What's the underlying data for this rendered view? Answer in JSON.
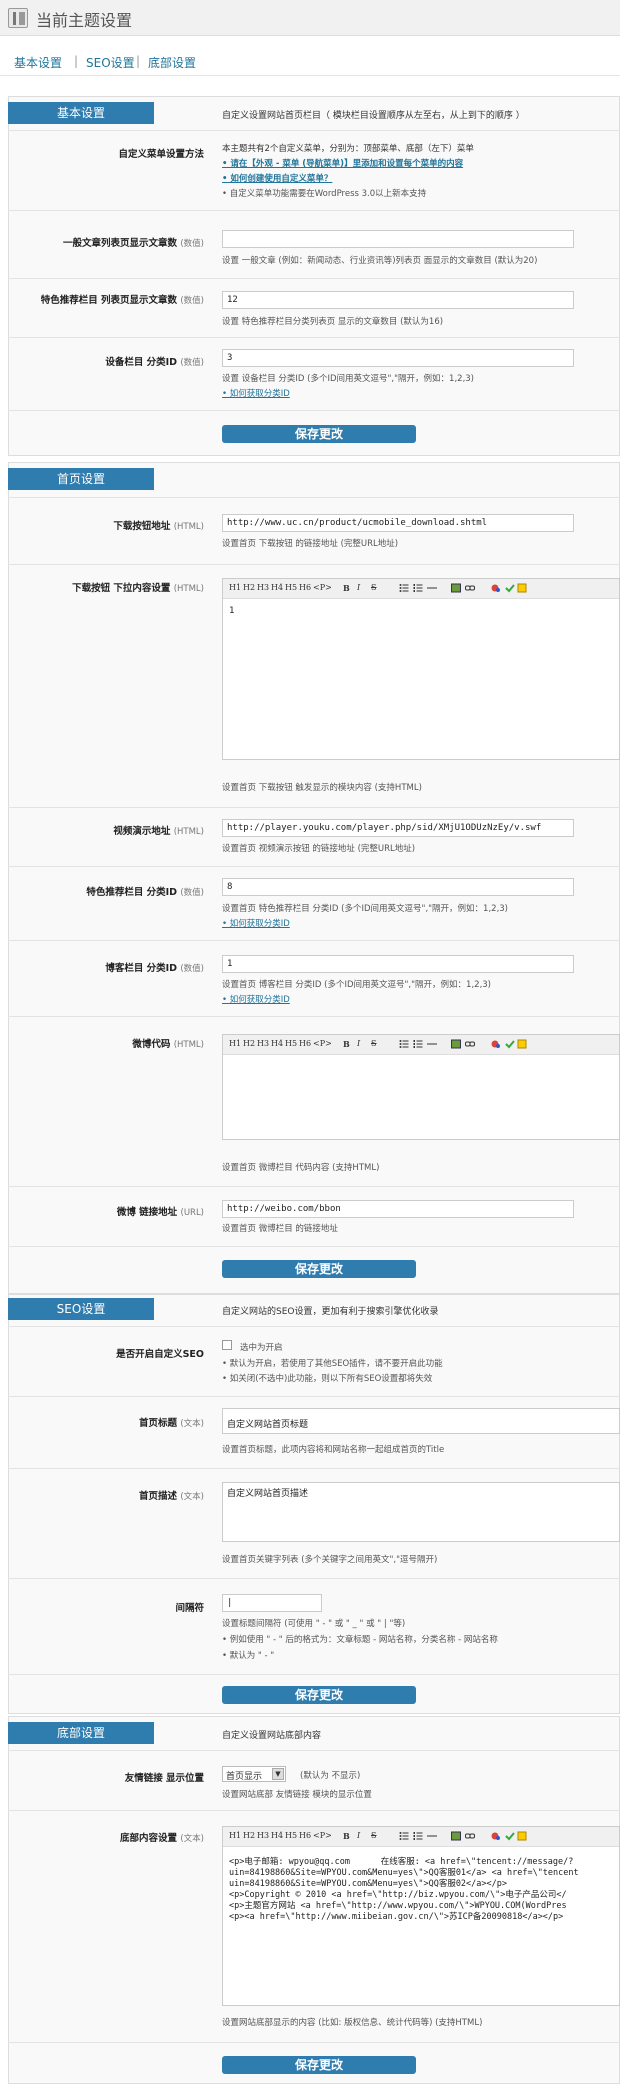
{
  "page": {
    "title": "当前主题设置"
  },
  "nav": {
    "items": [
      "基本设置",
      "SEO设置",
      "底部设置"
    ],
    "separator": "|"
  },
  "save_label": "保存更改",
  "basic": {
    "title": "基本设置",
    "desc": "自定义设置网站首页栏目（ 模块栏目设置顺序从左至右，从上到下的顺序 ）",
    "menu": {
      "label": "自定义菜单设置方法",
      "line1": "本主题共有2个自定义菜单，分别为：顶部菜单、底部（左下）菜单",
      "line2": "• 请在【外观 - 菜单 (导航菜单)】里添加和设置每个菜单的内容",
      "line3": "• 如何创建使用自定义菜单？",
      "line4": "• 自定义菜单功能需要在WordPress 3.0以上新本支持"
    },
    "post_count": {
      "label": "一般文章列表页显示文章数",
      "sub": "(数值)",
      "value": "",
      "hint": "设置 一般文章 (例如：新闻动态、行业资讯等)列表页 面显示的文章数目 (默认为20)"
    },
    "featured_count": {
      "label": "特色推荐栏目 列表页显示文章数",
      "sub": "(数值)",
      "value": "12",
      "hint": "设置 特色推荐栏目分类列表页 显示的文章数目 (默认为16)"
    },
    "device_cat": {
      "label": "设备栏目 分类ID",
      "sub": "(数值)",
      "value": "3",
      "hint": "设置 设备栏目 分类ID (多个ID间用英文逗号\",\"隔开，例如：1,2,3)",
      "link": "• 如何获取分类ID"
    }
  },
  "home": {
    "title": "首页设置",
    "download_url": {
      "label": "下载按钮地址",
      "sub": "(HTML)",
      "value": "http://www.uc.cn/product/ucmobile_download.shtml",
      "hint": "设置首页 下载按钮 的链接地址 (完整URL地址)"
    },
    "download_menu": {
      "label": "下载按钮 下拉内容设置",
      "sub": "(HTML)",
      "value": "1",
      "hint": "设置首页 下载按钮 触发显示的模块内容 (支持HTML)"
    },
    "video_url": {
      "label": "视频演示地址",
      "sub": "(HTML)",
      "value": "http://player.youku.com/player.php/sid/XMjU1ODUzNzEy/v.swf",
      "hint": "设置首页 视频演示按钮 的链接地址 (完整URL地址)"
    },
    "featured_cat": {
      "label": "特色推荐栏目 分类ID",
      "sub": "(数值)",
      "value": "8",
      "hint": "设置首页 特色推荐栏目 分类ID (多个ID间用英文逗号\",\"隔开，例如：1,2,3)",
      "link": "• 如何获取分类ID"
    },
    "blog_cat": {
      "label": "博客栏目 分类ID",
      "sub": "(数值)",
      "value": "1",
      "hint": "设置首页 博客栏目 分类ID (多个ID间用英文逗号\",\"隔开，例如：1,2,3)",
      "link": "• 如何获取分类ID"
    },
    "weibo_code": {
      "label": "微博代码",
      "sub": "(HTML)",
      "value": "",
      "hint": "设置首页 微博栏目 代码内容 (支持HTML)"
    },
    "weibo_url": {
      "label": "微博 链接地址",
      "sub": "(URL)",
      "value": "http://weibo.com/bbon",
      "hint": "设置首页 微博栏目 的链接地址"
    }
  },
  "seo": {
    "title": "SEO设置",
    "desc": "自定义网站的SEO设置，更加有利于搜索引擎优化收录",
    "enable": {
      "label": "是否开启自定义SEO",
      "check_label": "选中为开启",
      "hint1": "• 默认为开启，若使用了其他SEO插件，请不要开启此功能",
      "hint2": "• 如关闭(不选中)此功能，则以下所有SEO设置都将失效"
    },
    "home_title": {
      "label": "首页标题",
      "sub": "(文本)",
      "value": "自定义网站首页标题",
      "hint": "设置首页标题，此项内容将和网站名称一起组成首页的Title"
    },
    "home_desc": {
      "label": "首页描述",
      "sub": "(文本)",
      "value": "自定义网站首页描述",
      "hint": "设置首页关键字列表 (多个关键字之间用英文\",\"逗号隔开)"
    },
    "separator": {
      "label": "间隔符",
      "value": "|",
      "hint1": "设置标题间隔符 (可使用 \" - \" 或 \" _ \" 或 \" | \"等)",
      "hint2": "• 例如使用 \" - \" 后的格式为：文章标题 - 网站名称，分类名称 - 网站名称",
      "hint3": "• 默认为 \" - \""
    }
  },
  "footer": {
    "title": "底部设置",
    "desc": "自定义设置网站底部内容",
    "links": {
      "label": "友情链接 显示位置",
      "select_value": "首页显示",
      "default_note": "(默认为 不显示)",
      "hint": "设置网站底部 友情链接 模块的显示位置"
    },
    "content": {
      "label": "底部内容设置",
      "sub": "(文本)",
      "lines": [
        "<p>电子邮箱: wpyou@qq.com      在线客服: <a href=\\\"tencent://message/?",
        "uin=84198860&Site=WPYOU.com&Menu=yes\\\">QQ客服01</a> <a href=\\\"tencent",
        "uin=84198860&Site=WPYOU.com&Menu=yes\\\">QQ客服02</a></p>",
        "<p>Copyright © 2010 <a href=\\\"http://biz.wpyou.com/\\\">电子产品公司</",
        "<p>主题官方网站 <a href=\\\"http://www.wpyou.com/\\\">WPYOU.COM(WordPres",
        "<p><a href=\\\"http://www.miibeian.gov.cn/\\\">苏ICP备20090818</a></p>"
      ],
      "hint": "设置网站底部显示的内容 (比如: 版权信息、统计代码等) (支持HTML)"
    }
  },
  "toolbar": {
    "headings": [
      "H1",
      "H2",
      "H3",
      "H4",
      "H5",
      "H6",
      "<P>"
    ],
    "bold": "B",
    "italic": "I",
    "strike": "S"
  }
}
